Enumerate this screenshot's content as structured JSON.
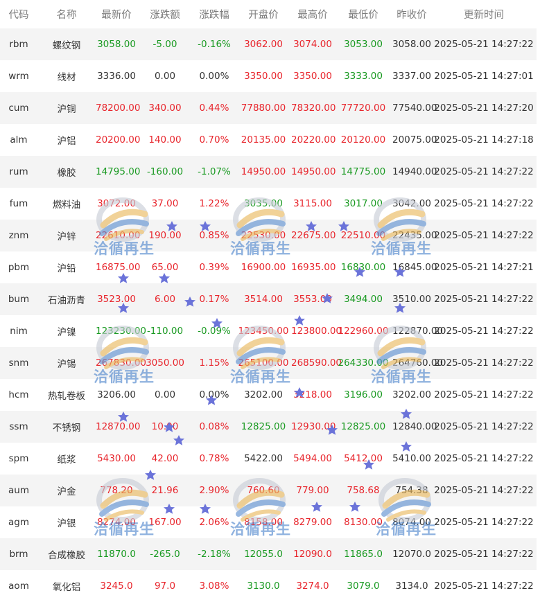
{
  "columns": [
    "代码",
    "名称",
    "最新价",
    "涨跌额",
    "涨跌幅",
    "开盘价",
    "最高价",
    "最低价",
    "昨收价",
    "更新时间"
  ],
  "rows": [
    {
      "code": "rbm",
      "name": "螺纹钢",
      "last": "3058.00",
      "change": "-5.00",
      "pct": "-0.16%",
      "open": "3062.00",
      "high": "3074.00",
      "low": "3053.00",
      "prev": "3058.00",
      "time": "2025-05-21 14:27:22",
      "colors": [
        "down",
        "down",
        "down",
        "up",
        "up",
        "down",
        "flat"
      ]
    },
    {
      "code": "wrm",
      "name": "线材",
      "last": "3336.00",
      "change": "0.00",
      "pct": "0.00%",
      "open": "3350.00",
      "high": "3350.00",
      "low": "3333.00",
      "prev": "3337.00",
      "time": "2025-05-21 14:27:01",
      "colors": [
        "flat",
        "flat",
        "flat",
        "up",
        "up",
        "down",
        "flat"
      ]
    },
    {
      "code": "cum",
      "name": "沪铜",
      "last": "78200.00",
      "change": "340.00",
      "pct": "0.44%",
      "open": "77880.00",
      "high": "78320.00",
      "low": "77720.00",
      "prev": "77540.00",
      "time": "2025-05-21 14:27:20",
      "colors": [
        "up",
        "up",
        "up",
        "up",
        "up",
        "up",
        "flat"
      ]
    },
    {
      "code": "alm",
      "name": "沪铝",
      "last": "20200.00",
      "change": "140.00",
      "pct": "0.70%",
      "open": "20135.00",
      "high": "20220.00",
      "low": "20120.00",
      "prev": "20075.00",
      "time": "2025-05-21 14:27:18",
      "colors": [
        "up",
        "up",
        "up",
        "up",
        "up",
        "up",
        "flat"
      ]
    },
    {
      "code": "rum",
      "name": "橡胶",
      "last": "14795.00",
      "change": "-160.00",
      "pct": "-1.07%",
      "open": "14950.00",
      "high": "14950.00",
      "low": "14775.00",
      "prev": "14940.00",
      "time": "2025-05-21 14:27:22",
      "colors": [
        "down",
        "down",
        "down",
        "up",
        "up",
        "down",
        "flat"
      ]
    },
    {
      "code": "fum",
      "name": "燃料油",
      "last": "3072.00",
      "change": "37.00",
      "pct": "1.22%",
      "open": "3035.00",
      "high": "3115.00",
      "low": "3017.00",
      "prev": "3042.00",
      "time": "2025-05-21 14:27:22",
      "colors": [
        "up",
        "up",
        "up",
        "down",
        "up",
        "down",
        "flat"
      ]
    },
    {
      "code": "znm",
      "name": "沪锌",
      "last": "22610.00",
      "change": "190.00",
      "pct": "0.85%",
      "open": "22530.00",
      "high": "22675.00",
      "low": "22510.00",
      "prev": "22435.00",
      "time": "2025-05-21 14:27:22",
      "colors": [
        "up",
        "up",
        "up",
        "up",
        "up",
        "up",
        "flat"
      ]
    },
    {
      "code": "pbm",
      "name": "沪铅",
      "last": "16875.00",
      "change": "65.00",
      "pct": "0.39%",
      "open": "16900.00",
      "high": "16935.00",
      "low": "16830.00",
      "prev": "16845.00",
      "time": "2025-05-21 14:27:21",
      "colors": [
        "up",
        "up",
        "up",
        "up",
        "up",
        "down",
        "flat"
      ]
    },
    {
      "code": "bum",
      "name": "石油沥青",
      "last": "3523.00",
      "change": "6.00",
      "pct": "0.17%",
      "open": "3514.00",
      "high": "3553.00",
      "low": "3494.00",
      "prev": "3510.00",
      "time": "2025-05-21 14:27:22",
      "colors": [
        "up",
        "up",
        "up",
        "up",
        "up",
        "down",
        "flat"
      ]
    },
    {
      "code": "nim",
      "name": "沪镍",
      "last": "123230.00",
      "change": "-110.00",
      "pct": "-0.09%",
      "open": "123450.00",
      "high": "123800.00",
      "low": "122960.00",
      "prev": "122870.00",
      "time": "2025-05-21 14:27:22",
      "colors": [
        "down",
        "down",
        "down",
        "up",
        "up",
        "up",
        "flat"
      ]
    },
    {
      "code": "snm",
      "name": "沪锡",
      "last": "267830.00",
      "change": "3050.00",
      "pct": "1.15%",
      "open": "265100.00",
      "high": "268590.00",
      "low": "264330.00",
      "prev": "264760.00",
      "time": "2025-05-21 14:27:22",
      "colors": [
        "up",
        "up",
        "up",
        "up",
        "up",
        "down",
        "flat"
      ]
    },
    {
      "code": "hcm",
      "name": "热轧卷板",
      "last": "3206.00",
      "change": "0.00",
      "pct": "0.00%",
      "open": "3202.00",
      "high": "3218.00",
      "low": "3196.00",
      "prev": "3202.00",
      "time": "2025-05-21 14:27:22",
      "colors": [
        "flat",
        "flat",
        "flat",
        "flat",
        "up",
        "down",
        "flat"
      ]
    },
    {
      "code": "ssm",
      "name": "不锈钢",
      "last": "12870.00",
      "change": "10.00",
      "pct": "0.08%",
      "open": "12825.00",
      "high": "12930.00",
      "low": "12825.00",
      "prev": "12840.00",
      "time": "2025-05-21 14:27:22",
      "colors": [
        "up",
        "up",
        "up",
        "down",
        "up",
        "down",
        "flat"
      ]
    },
    {
      "code": "spm",
      "name": "纸浆",
      "last": "5430.00",
      "change": "42.00",
      "pct": "0.78%",
      "open": "5422.00",
      "high": "5494.00",
      "low": "5412.00",
      "prev": "5410.00",
      "time": "2025-05-21 14:27:22",
      "colors": [
        "up",
        "up",
        "up",
        "flat",
        "up",
        "up",
        "flat"
      ]
    },
    {
      "code": "aum",
      "name": "沪金",
      "last": "778.20",
      "change": "21.96",
      "pct": "2.90%",
      "open": "760.60",
      "high": "779.00",
      "low": "758.68",
      "prev": "754.38",
      "time": "2025-05-21 14:27:22",
      "colors": [
        "up",
        "up",
        "up",
        "up",
        "up",
        "up",
        "flat"
      ]
    },
    {
      "code": "agm",
      "name": "沪银",
      "last": "8274.00",
      "change": "167.00",
      "pct": "2.06%",
      "open": "8158.00",
      "high": "8279.00",
      "low": "8130.00",
      "prev": "8074.00",
      "time": "2025-05-21 14:27:22",
      "colors": [
        "up",
        "up",
        "up",
        "up",
        "up",
        "up",
        "flat"
      ]
    },
    {
      "code": "brm",
      "name": "合成橡胶",
      "last": "11870.0",
      "change": "-265.0",
      "pct": "-2.18%",
      "open": "12055.0",
      "high": "12090.0",
      "low": "11865.0",
      "prev": "12070.0",
      "time": "2025-05-21 14:27:22",
      "colors": [
        "down",
        "down",
        "down",
        "down",
        "up",
        "down",
        "flat"
      ]
    },
    {
      "code": "aom",
      "name": "氧化铝",
      "last": "3245.0",
      "change": "97.0",
      "pct": "3.08%",
      "open": "3130.0",
      "high": "3274.0",
      "low": "3079.0",
      "prev": "3134.0",
      "time": "2025-05-21 14:27:22",
      "colors": [
        "up",
        "up",
        "up",
        "down",
        "up",
        "down",
        "flat"
      ]
    }
  ],
  "watermark": {
    "text": "洽循再生",
    "text_color": "#4c84cc",
    "ring_colors": [
      "#e9b75a",
      "#5a8ed0",
      "#c8cdd6"
    ]
  },
  "theme": {
    "up": "#e8262d",
    "down": "#1a9a22",
    "header_text": "#7d7d7d",
    "stripe": "#f4f4f4",
    "star": "#6b73d9"
  }
}
